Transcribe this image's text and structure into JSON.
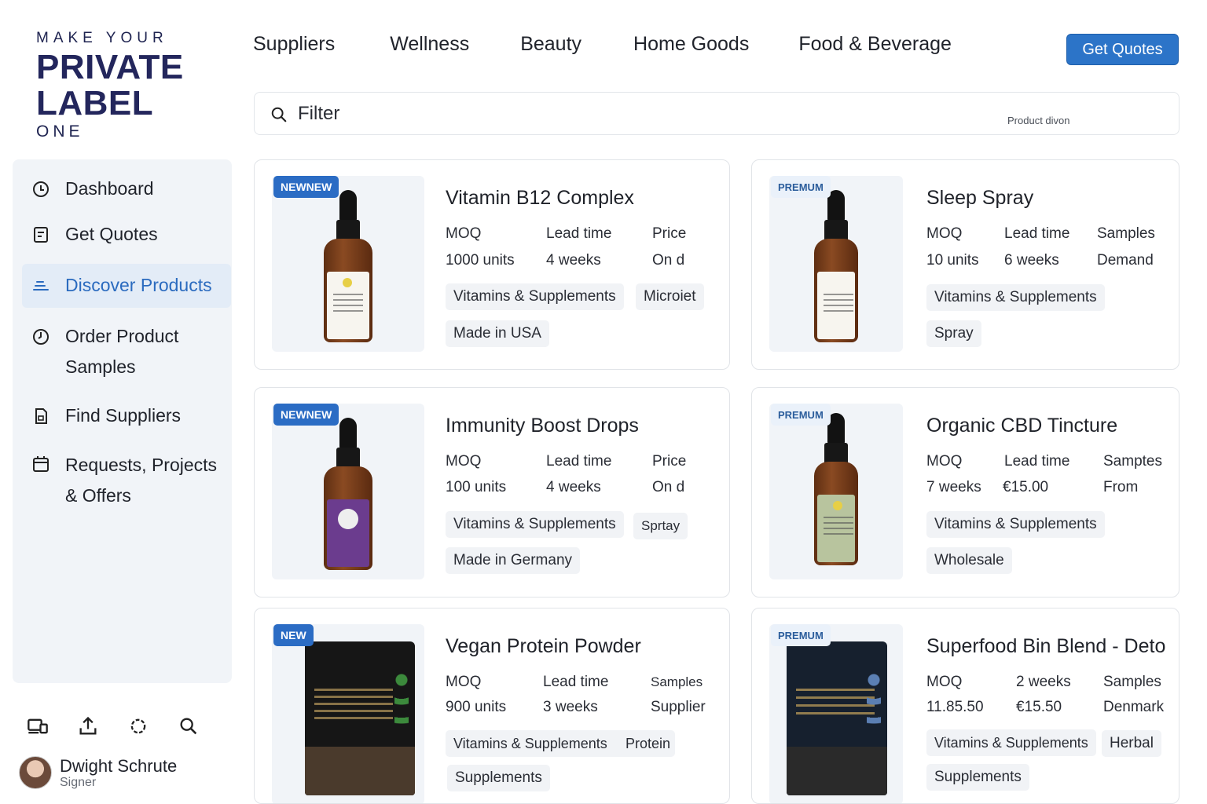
{
  "logo": {
    "line1": "MAKE YOUR",
    "line2": "PRIVATE",
    "line3": "LABEL",
    "line4": "ONE"
  },
  "nav": {
    "links": [
      "Suppliers",
      "Wellness",
      "Beauty",
      "Home Goods",
      "Food & Beverage"
    ],
    "cta": "Get Quotes"
  },
  "filter": {
    "placeholder": "Filter",
    "hint": "Product divon"
  },
  "sidebar": {
    "items": [
      {
        "label": "Dashboard",
        "icon": "dashboard-icon"
      },
      {
        "label": "Get Quotes",
        "icon": "quotes-icon"
      },
      {
        "label": "Discover Products",
        "icon": "discover-icon",
        "active": true
      },
      {
        "label": "Order Product Samples",
        "icon": "clock-icon"
      },
      {
        "label": "Find Suppliers",
        "icon": "document-icon"
      },
      {
        "label": "Requests, Projects & Offers",
        "icon": "calendar-icon"
      }
    ],
    "bottom_icons": [
      "devices-icon",
      "upload-icon",
      "settings-icon",
      "search-icon"
    ]
  },
  "user": {
    "name": "Dwight Schrute",
    "role": "Signer"
  },
  "colors": {
    "accent": "#2c74c8",
    "sidebar_bg": "#f1f4f8",
    "active_bg": "#e3ecf7",
    "active_text": "#2b6bbf"
  },
  "products": [
    {
      "badge": "NEWNEW",
      "badge_type": "new",
      "title": "Vitamin B12 Complex",
      "specs": [
        {
          "label": "MOQ",
          "value": "1000 units"
        },
        {
          "label": "Lead time",
          "value": "4 weeks"
        },
        {
          "label": "Price",
          "value": "On d"
        }
      ],
      "tags": [
        "Vitamins & Supplements",
        "Microiet",
        "Made in USA"
      ],
      "image": "bottle-white"
    },
    {
      "badge": "PREMUM",
      "badge_type": "premium",
      "title": "Sleep Spray",
      "specs": [
        {
          "label": "MOQ",
          "value": "10 units"
        },
        {
          "label": "Lead time",
          "value": "6 weeks"
        },
        {
          "label": "Samples",
          "value": "Demand"
        }
      ],
      "tags": [
        "Vitamins & Supplements",
        "Spray"
      ],
      "image": "bottle-white-tall"
    },
    {
      "badge": "NEWNEW",
      "badge_type": "new",
      "title": "Immunity Boost Drops",
      "specs": [
        {
          "label": "MOQ",
          "value": "100 units"
        },
        {
          "label": "Lead time",
          "value": "4 weeks"
        },
        {
          "label": "Price",
          "value": "On d"
        }
      ],
      "tags": [
        "Vitamins & Supplements",
        "Sprtay",
        "Made in Germany"
      ],
      "image": "bottle-purple"
    },
    {
      "badge": "PREMUM",
      "badge_type": "premium",
      "title": "Organic CBD Tincture",
      "specs": [
        {
          "label": "MOQ",
          "value": "7 weeks"
        },
        {
          "label": "Lead time",
          "value": "€15.00"
        },
        {
          "label": "Samptes",
          "value": "From"
        }
      ],
      "tags": [
        "Vitamins & Supplements",
        "Wholesale"
      ],
      "image": "bottle-green"
    },
    {
      "badge": "NEW",
      "badge_type": "new",
      "title": "Vegan Protein Powder",
      "specs": [
        {
          "label": "MOQ",
          "value": "900 units"
        },
        {
          "label": "Lead time",
          "value": "3 weeks"
        },
        {
          "label": "Samples",
          "value": "Supplier"
        }
      ],
      "tags": [
        "Vitamins & Supplements",
        "Protein",
        "Supplements"
      ],
      "image": "pouch-black"
    },
    {
      "badge": "PREMUM",
      "badge_type": "premium",
      "title": "Superfood Bin Blend - Deto",
      "specs": [
        {
          "label": "MOQ",
          "value": "11.85.50"
        },
        {
          "label": "2 weeks",
          "value": "€15.50"
        },
        {
          "label": "Samples",
          "value": "Denmark"
        }
      ],
      "tags": [
        "Vitamins & Supplements",
        "Herbal",
        "Supplements"
      ],
      "image": "pouch-navy"
    }
  ]
}
